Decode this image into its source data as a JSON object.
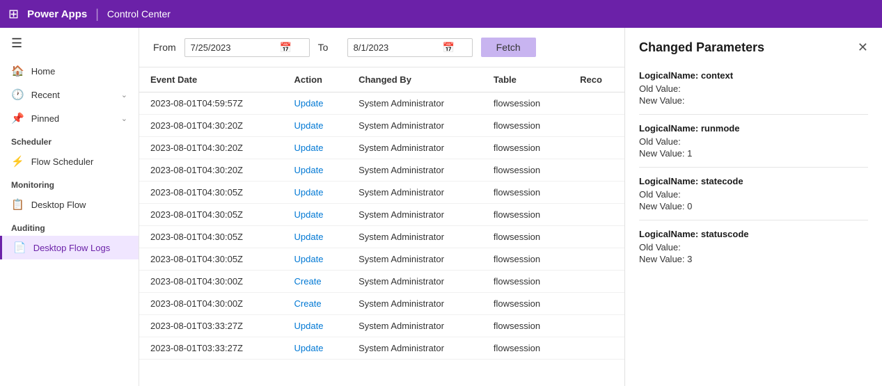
{
  "topbar": {
    "app_name": "Power Apps",
    "divider": "|",
    "module_name": "Control Center"
  },
  "sidebar": {
    "hamburger_icon": "☰",
    "items": [
      {
        "id": "home",
        "label": "Home",
        "icon": "🏠",
        "hasChevron": false
      },
      {
        "id": "recent",
        "label": "Recent",
        "icon": "🕐",
        "hasChevron": true
      },
      {
        "id": "pinned",
        "label": "Pinned",
        "icon": "📌",
        "hasChevron": true
      }
    ],
    "scheduler_label": "Scheduler",
    "scheduler_items": [
      {
        "id": "flow-scheduler",
        "label": "Flow Scheduler",
        "icon": "⚡"
      }
    ],
    "monitoring_label": "Monitoring",
    "monitoring_items": [
      {
        "id": "desktop-flow",
        "label": "Desktop Flow",
        "icon": "📋"
      }
    ],
    "auditing_label": "Auditing",
    "auditing_items": [
      {
        "id": "desktop-flow-logs",
        "label": "Desktop Flow Logs",
        "icon": "📄",
        "active": true
      }
    ]
  },
  "filter_bar": {
    "from_label": "From",
    "from_date": "7/25/2023",
    "to_label": "To",
    "to_date": "8/1/2023",
    "fetch_label": "Fetch",
    "calendar_icon": "📅"
  },
  "table": {
    "columns": [
      "Event Date",
      "Action",
      "Changed By",
      "Table",
      "Reco"
    ],
    "rows": [
      {
        "event_date": "2023-08-01T04:59:57Z",
        "action": "Update",
        "changed_by": "System Administrator",
        "table": "flowsession",
        "reco": ""
      },
      {
        "event_date": "2023-08-01T04:30:20Z",
        "action": "Update",
        "changed_by": "System Administrator",
        "table": "flowsession",
        "reco": ""
      },
      {
        "event_date": "2023-08-01T04:30:20Z",
        "action": "Update",
        "changed_by": "System Administrator",
        "table": "flowsession",
        "reco": ""
      },
      {
        "event_date": "2023-08-01T04:30:20Z",
        "action": "Update",
        "changed_by": "System Administrator",
        "table": "flowsession",
        "reco": ""
      },
      {
        "event_date": "2023-08-01T04:30:05Z",
        "action": "Update",
        "changed_by": "System Administrator",
        "table": "flowsession",
        "reco": ""
      },
      {
        "event_date": "2023-08-01T04:30:05Z",
        "action": "Update",
        "changed_by": "System Administrator",
        "table": "flowsession",
        "reco": ""
      },
      {
        "event_date": "2023-08-01T04:30:05Z",
        "action": "Update",
        "changed_by": "System Administrator",
        "table": "flowsession",
        "reco": ""
      },
      {
        "event_date": "2023-08-01T04:30:05Z",
        "action": "Update",
        "changed_by": "System Administrator",
        "table": "flowsession",
        "reco": ""
      },
      {
        "event_date": "2023-08-01T04:30:00Z",
        "action": "Create",
        "changed_by": "System Administrator",
        "table": "flowsession",
        "reco": ""
      },
      {
        "event_date": "2023-08-01T04:30:00Z",
        "action": "Create",
        "changed_by": "System Administrator",
        "table": "flowsession",
        "reco": ""
      },
      {
        "event_date": "2023-08-01T03:33:27Z",
        "action": "Update",
        "changed_by": "System Administrator",
        "table": "flowsession",
        "reco": ""
      },
      {
        "event_date": "2023-08-01T03:33:27Z",
        "action": "Update",
        "changed_by": "System Administrator",
        "table": "flowsession",
        "reco": ""
      }
    ]
  },
  "right_panel": {
    "title": "Changed Parameters",
    "close_icon": "✕",
    "params": [
      {
        "logical_name": "LogicalName: context",
        "old_value": "Old Value:",
        "new_value": "New Value:"
      },
      {
        "logical_name": "LogicalName: runmode",
        "old_value": "Old Value:",
        "new_value": "New Value: 1"
      },
      {
        "logical_name": "LogicalName: statecode",
        "old_value": "Old Value:",
        "new_value": "New Value: 0"
      },
      {
        "logical_name": "LogicalName: statuscode",
        "old_value": "Old Value:",
        "new_value": "New Value: 3"
      }
    ]
  }
}
